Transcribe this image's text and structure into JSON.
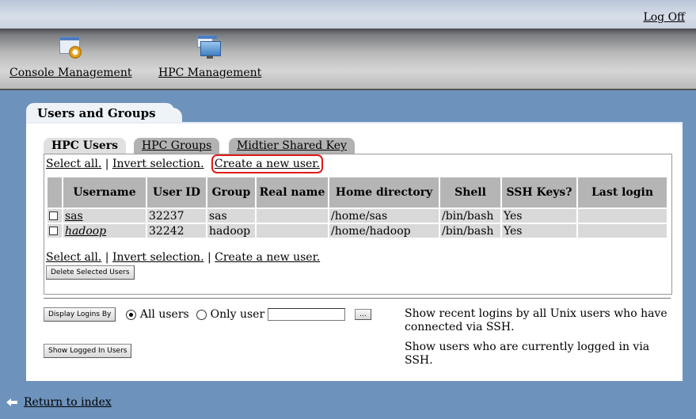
{
  "header": {
    "logoff": "Log Off"
  },
  "modules": [
    {
      "label": "Console Management",
      "icon": "console-gear-icon"
    },
    {
      "label": "HPC Management",
      "icon": "monitor-icon"
    }
  ],
  "panel": {
    "title": "Users and Groups"
  },
  "tabs": [
    {
      "label": "HPC Users",
      "active": true
    },
    {
      "label": "HPC Groups",
      "active": false
    },
    {
      "label": "Midtier Shared Key",
      "active": false
    }
  ],
  "links": {
    "select_all": "Select all.",
    "sep": " | ",
    "invert": "Invert selection.",
    "create": "Create a new user."
  },
  "table": {
    "headers": [
      "Username",
      "User ID",
      "Group",
      "Real name",
      "Home directory",
      "Shell",
      "SSH Keys?",
      "Last login"
    ],
    "rows": [
      {
        "username": "sas",
        "user_id": "32237",
        "group": "sas",
        "real_name": "",
        "home": "/home/sas",
        "shell": "/bin/bash",
        "ssh_keys": "Yes",
        "last_login": ""
      },
      {
        "username": "hadoop",
        "user_id": "32242",
        "group": "hadoop",
        "real_name": "",
        "home": "/home/hadoop",
        "shell": "/bin/bash",
        "ssh_keys": "Yes",
        "last_login": ""
      }
    ]
  },
  "buttons": {
    "delete_selected": "Delete Selected Users",
    "display_logins": "Display Logins By",
    "browse": "...",
    "show_logged_in": "Show Logged In Users"
  },
  "logins": {
    "all_users": "All users",
    "only_user": "Only user",
    "only_user_value": "",
    "desc_recent": "Show recent logins by all Unix users who have connected via SSH.",
    "desc_current": "Show users who are currently logged in via SSH."
  },
  "footer": {
    "return": "Return to index"
  },
  "colors": {
    "background": "#6d93bd",
    "highlight": "#e21b1b"
  }
}
